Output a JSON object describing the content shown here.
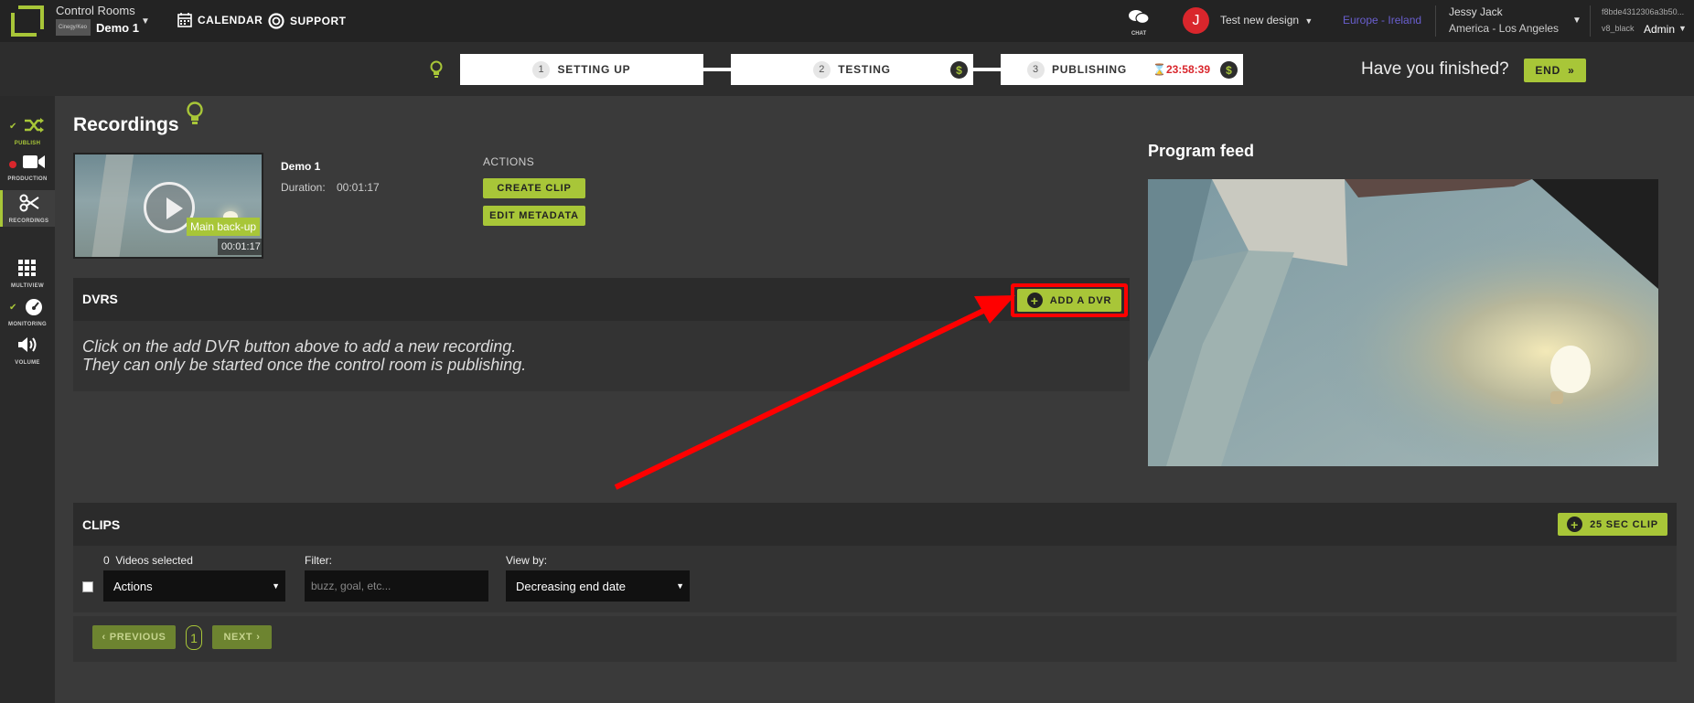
{
  "header": {
    "app_title": "Control Rooms",
    "org_badge": "Cinegy/Keo",
    "room_name": "Demo 1",
    "nav": [
      {
        "label": "CALENDAR",
        "icon": "calendar-icon"
      },
      {
        "label": "SUPPORT",
        "icon": "lifebuoy-icon"
      }
    ],
    "chat_label": "CHAT",
    "avatar_initial": "J",
    "design_label": "Test new design",
    "region": "Europe - Ireland",
    "user_name": "Jessy Jack",
    "timezone": "America - Los Angeles",
    "account_hash": "f8bde4312306a3b50...",
    "account_name": "v8_black",
    "role": "Admin"
  },
  "steps": {
    "items": [
      {
        "num": "1",
        "label": "SETTING UP"
      },
      {
        "num": "2",
        "label": "TESTING"
      },
      {
        "num": "3",
        "label": "PUBLISHING"
      }
    ],
    "dollar_sign": "$",
    "timer": "23:58:39",
    "finished_question": "Have you finished?",
    "end_label": "END"
  },
  "sidebar": {
    "items": [
      {
        "label": "PUBLISH",
        "icon": "shuffle-icon"
      },
      {
        "label": "PRODUCTION",
        "icon": "video-camera-icon"
      },
      {
        "label": "RECORDINGS",
        "icon": "scissors-icon"
      },
      {
        "label": "MULTIVIEW",
        "icon": "grid-icon"
      },
      {
        "label": "MONITORING",
        "icon": "gauge-icon"
      },
      {
        "label": "VOLUME",
        "icon": "speaker-icon"
      }
    ]
  },
  "recordings": {
    "title": "Recordings",
    "item": {
      "name": "Demo 1",
      "duration_label": "Duration:",
      "duration": "00:01:17",
      "badge": "Main back-up",
      "thumb_duration": "00:01:17"
    },
    "actions_label": "ACTIONS",
    "create_clip": "CREATE CLIP",
    "edit_metadata": "EDIT METADATA"
  },
  "dvrs": {
    "title": "DVRS",
    "add_label": "ADD A DVR",
    "message_line1": "Click on the add DVR button above to add a new recording.",
    "message_line2": "They can only be started once the control room is publishing."
  },
  "program_feed": {
    "title": "Program feed"
  },
  "clips": {
    "title": "CLIPS",
    "sec_clip_label": "25 SEC CLIP",
    "selected_count": "0",
    "selected_label": "Videos selected",
    "actions_value": "Actions",
    "filter_label": "Filter:",
    "filter_placeholder": "buzz, goal, etc...",
    "view_by_label": "View by:",
    "view_by_value": "Decreasing end date",
    "previous": "PREVIOUS",
    "page": "1",
    "next": "NEXT"
  },
  "colors": {
    "accent": "#a8c638",
    "danger": "#d9262c",
    "topbar": "#232323",
    "background": "#3a3a3a"
  }
}
